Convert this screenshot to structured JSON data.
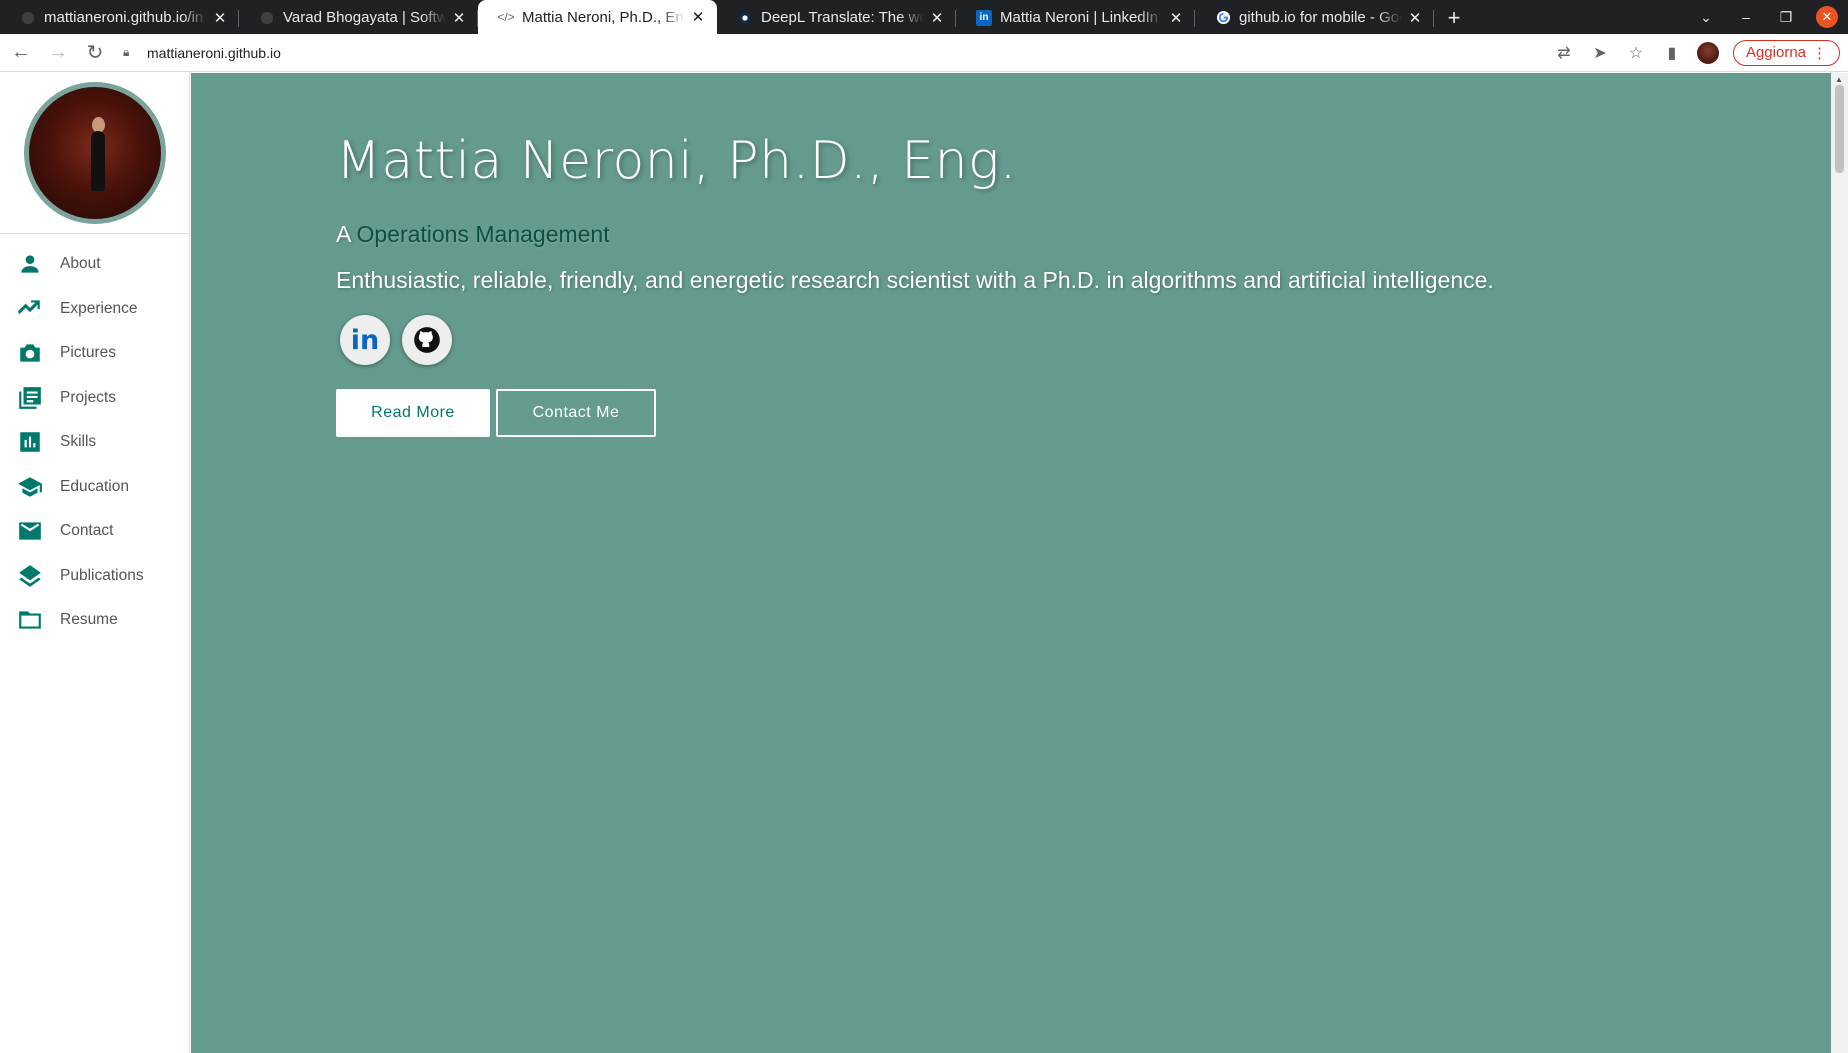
{
  "browser": {
    "tabs": [
      {
        "title": "mattianeroni.github.io/in",
        "icon": "github-icon"
      },
      {
        "title": "Varad Bhogayata | Softwa",
        "icon": "github-icon"
      },
      {
        "title": "Mattia Neroni, Ph.D., Eng",
        "icon": "code-icon",
        "active": true
      },
      {
        "title": "DeepL Translate: The wor",
        "icon": "deepl-icon"
      },
      {
        "title": "Mattia Neroni | LinkedIn",
        "icon": "linkedin-icon"
      },
      {
        "title": "github.io for mobile - Goo",
        "icon": "google-icon"
      }
    ],
    "url": "mattianeroni.github.io",
    "update_label": "Aggiorna"
  },
  "sidebar": {
    "items": [
      {
        "label": "About",
        "icon": "person-icon"
      },
      {
        "label": "Experience",
        "icon": "trending-up-icon"
      },
      {
        "label": "Pictures",
        "icon": "camera-icon"
      },
      {
        "label": "Projects",
        "icon": "library-books-icon"
      },
      {
        "label": "Skills",
        "icon": "bar-chart-icon"
      },
      {
        "label": "Education",
        "icon": "school-icon"
      },
      {
        "label": "Contact",
        "icon": "email-icon"
      },
      {
        "label": "Publications",
        "icon": "layers-icon"
      },
      {
        "label": "Resume",
        "icon": "folder-icon"
      }
    ]
  },
  "hero": {
    "name": "Mattia Neroni, Ph.D., Eng.",
    "role_prefix": "A",
    "role": "Operations Management",
    "description": "Enthusiastic, reliable, friendly, and energetic research scientist with a Ph.D. in algorithms and artificial intelligence.",
    "read_more_label": "Read More",
    "contact_label": "Contact Me"
  },
  "colors": {
    "hero_bg": "#659b8e",
    "accent": "#00796b",
    "role_accent": "#0e4f45"
  }
}
